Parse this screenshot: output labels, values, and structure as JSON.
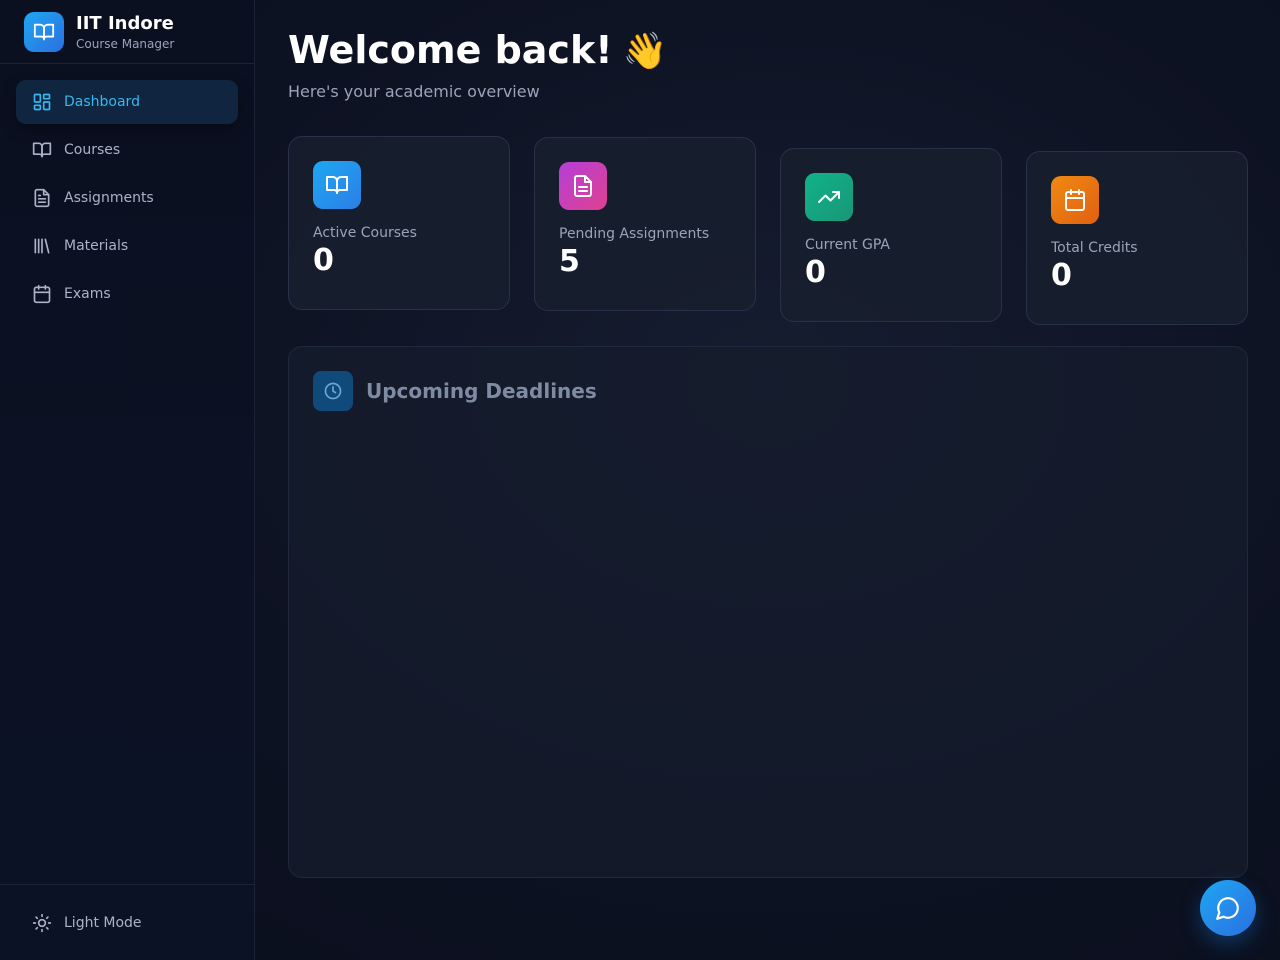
{
  "brand": {
    "title": "IIT Indore",
    "subtitle": "Course Manager",
    "icon": "book-open-icon"
  },
  "sidebar": {
    "items": [
      {
        "label": "Dashboard",
        "icon": "dashboard-grid-icon",
        "active": true
      },
      {
        "label": "Courses",
        "icon": "book-open-icon",
        "active": false
      },
      {
        "label": "Assignments",
        "icon": "file-text-icon",
        "active": false
      },
      {
        "label": "Materials",
        "icon": "library-icon",
        "active": false
      },
      {
        "label": "Exams",
        "icon": "calendar-icon",
        "active": false
      }
    ],
    "theme_toggle": {
      "label": "Light Mode",
      "icon": "sun-icon"
    }
  },
  "header": {
    "title": "Welcome back!",
    "emoji": "👋",
    "subtitle": "Here's your academic overview"
  },
  "stats": [
    {
      "label": "Active Courses",
      "value": "0",
      "icon": "book-open-icon",
      "color": "#1ea7f2"
    },
    {
      "label": "Pending Assignments",
      "value": "5",
      "icon": "file-text-icon",
      "color": "#c13fd0"
    },
    {
      "label": "Current GPA",
      "value": "0",
      "icon": "trending-up-icon",
      "color": "#14a683"
    },
    {
      "label": "Total Credits",
      "value": "0",
      "icon": "calendar-icon",
      "color": "#e57a10"
    }
  ],
  "deadlines": {
    "title": "Upcoming Deadlines",
    "icon": "clock-icon"
  },
  "chat": {
    "icon": "chat-bubble-icon"
  }
}
